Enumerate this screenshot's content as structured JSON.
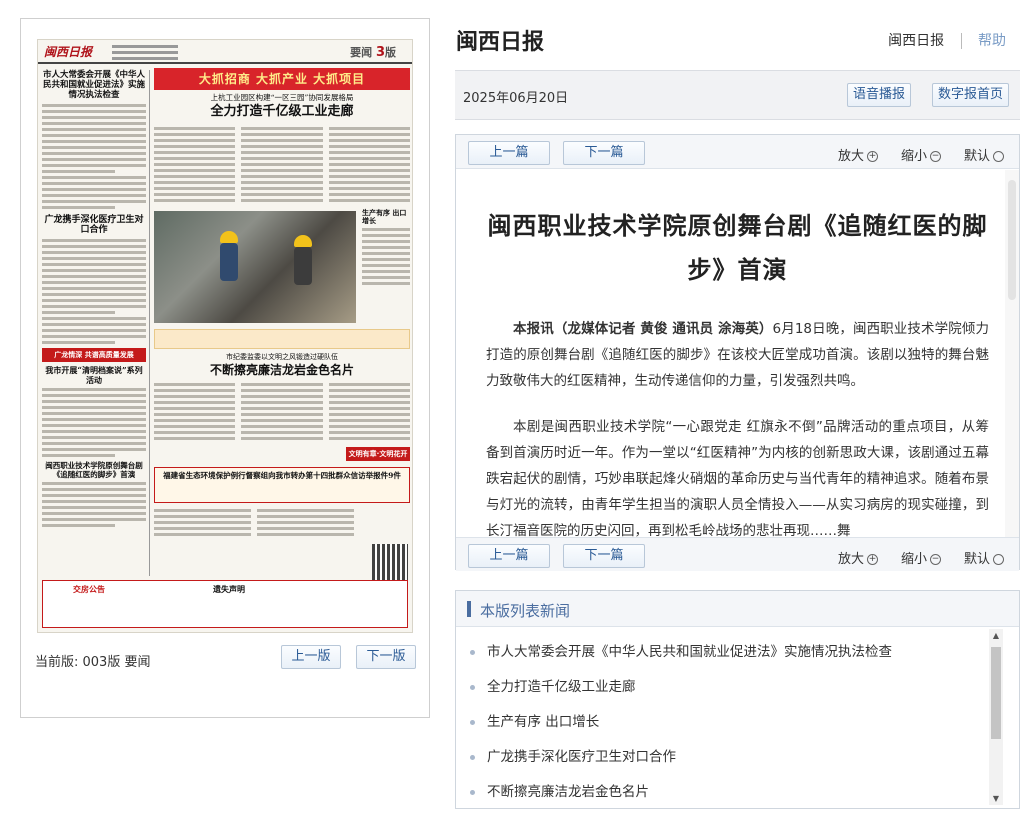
{
  "header": {
    "site_title": "闽西日报",
    "nav": {
      "home": "闽西日报",
      "help": "帮助"
    }
  },
  "date_bar": {
    "date": "2025年06月20日",
    "voice_btn": "语音播报",
    "digital_home_btn": "数字报首页"
  },
  "newspaper": {
    "logo": "闽西日报",
    "edition_label": "要闻",
    "edition_num": "3",
    "edition_suffix": "版",
    "left_col": {
      "h1": "市人大常委会开展《中华人民共和国就业促进法》实施情况执法检查",
      "h2": "广龙携手深化医疗卫生对口合作",
      "red_bar": "广龙情深 共谱高质量发展",
      "h3": "我市开展“清明档案说”系列活动",
      "h4": "闽西职业技术学院原创舞台剧《追随红医的脚步》首演"
    },
    "right_col": {
      "banner": "大抓招商  大抓产业  大抓项目",
      "sub": "上杭工业园区构建“一区三园”协同发展格局",
      "main_headline": "全力打造千亿级工业走廊",
      "side_headline": "生产有序 出口增长",
      "sub2": "市纪委监委以文明之风锻造过硬队伍",
      "headline2": "不断擦亮廉洁龙岩金色名片",
      "red_tag": "文明有章·文明花开",
      "gov_headline": "福建省生态环境保护例行督察组向我市转办第十四批群众信访举报件9件"
    },
    "ads": {
      "title1": "交房公告",
      "title2": "遗失声明"
    }
  },
  "left_footer": {
    "current_edition": "当前版: 003版 要闻",
    "prev_page": "上一版",
    "next_page": "下一版"
  },
  "article_toolbar": {
    "prev": "上一篇",
    "next": "下一篇",
    "zoom_in": "放大",
    "zoom_out": "缩小",
    "default": "默认"
  },
  "article": {
    "title": "闽西职业技术学院原创舞台剧《追随红医的脚步》首演",
    "byline": "本报讯（龙媒体记者 黄俊 通讯员 涂海英）",
    "para1_rest": "6月18日晚，闽西职业技术学院倾力打造的原创舞台剧《追随红医的脚步》在该校大匠堂成功首演。该剧以独特的舞台魅力致敬伟大的红医精神，生动传递信仰的力量，引发强烈共鸣。",
    "para2": "本剧是闽西职业技术学院“一心跟党走 红旗永不倒”品牌活动的重点项目，从筹备到首演历时近一年。作为一堂以“红医精神”为内核的创新思政大课，该剧通过五幕跌宕起伏的剧情，巧妙串联起烽火硝烟的革命历史与当代青年的精神追求。随着布景与灯光的流转，由青年学生担当的演职人员全情投入——从实习病房的现实碰撞，到长汀福音医院的历史闪回，再到松毛岭战场的悲壮再现……舞"
  },
  "news_list": {
    "title": "本版列表新闻",
    "items": [
      "市人大常委会开展《中华人民共和国就业促进法》实施情况执法检查",
      "全力打造千亿级工业走廊",
      "生产有序 出口增长",
      "广龙携手深化医疗卫生对口合作",
      "不断擦亮廉洁龙岩金色名片"
    ]
  }
}
